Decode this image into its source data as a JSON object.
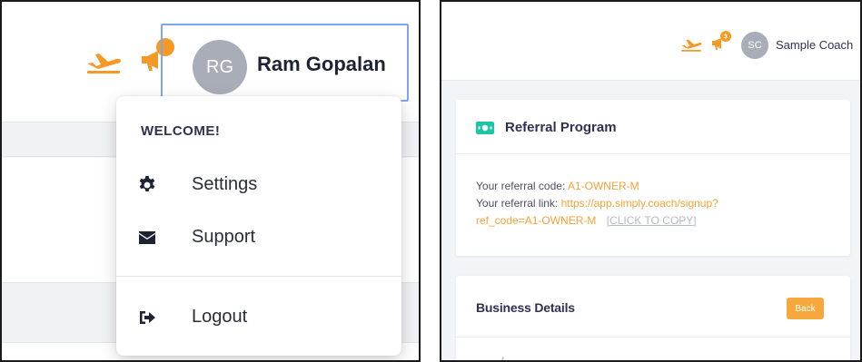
{
  "left": {
    "header": {
      "avatar_initials": "RG",
      "user_name": "Ram Gopalan",
      "plane_icon": "plane-icon",
      "announcement_icon": "megaphone-icon"
    },
    "dropdown": {
      "welcome": "WELCOME!",
      "items": [
        {
          "label": "Settings",
          "icon": "gear-icon"
        },
        {
          "label": "Support",
          "icon": "envelope-icon"
        },
        {
          "label": "Logout",
          "icon": "logout-icon"
        }
      ]
    }
  },
  "right": {
    "header": {
      "notification_count": "3",
      "avatar_initials": "SC",
      "user_name": "Sample Coach"
    },
    "referral": {
      "title": "Referral Program",
      "code_label": "Your referral code:",
      "code_value": "A1-OWNER-M",
      "link_label": "Your referral link:",
      "link_value_part1": "https://app.simply.coach/signup?",
      "link_value_part2": "ref_code=A1-OWNER-M",
      "copy_label": "[CLICK TO COPY]"
    },
    "business": {
      "title": "Business Details",
      "back_label": "Back"
    }
  },
  "colors": {
    "accent_orange": "#f5a23a",
    "profile_highlight": "#7ea6f0",
    "referral_icon": "#1cc6a4"
  }
}
